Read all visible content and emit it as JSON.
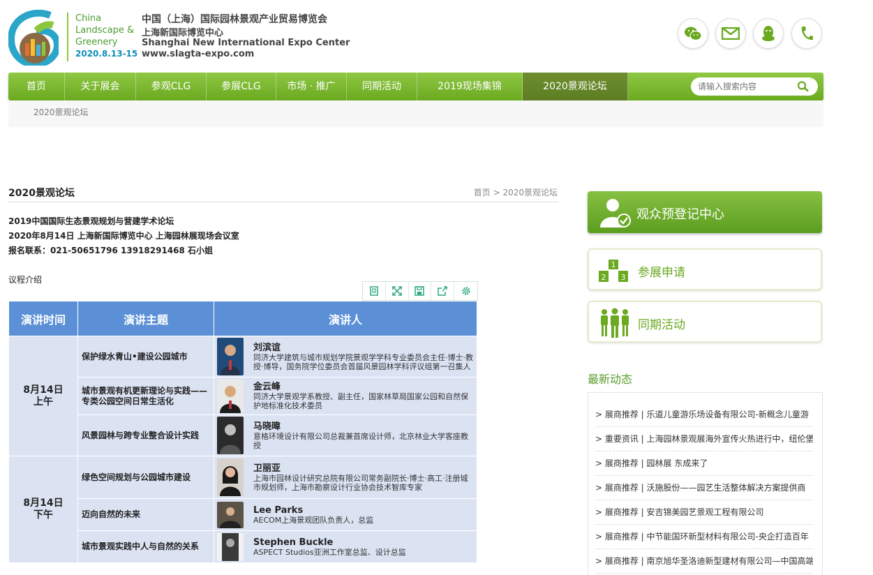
{
  "header": {
    "logo_lines": [
      "China",
      "Landscape &",
      "Greenery"
    ],
    "logo_date": "2020.8.13-15",
    "org_cn": "中国（上海）国际园林景观产业贸易博览会",
    "org_cn2": "上海新国际博览中心",
    "org_en": "Shanghai New International Expo Center",
    "url": "www.slagta-expo.com"
  },
  "nav": {
    "items": [
      "首页",
      "关于展会",
      "参观CLG",
      "参展CLG",
      "市场 · 推广",
      "同期活动",
      "2019现场集锦",
      "2020景观论坛"
    ],
    "active_index": 7,
    "search_placeholder": "请输入搜索内容"
  },
  "crumb_strip": "2020景观论坛",
  "main": {
    "title": "2020景观论坛",
    "breadcrumb": "首页 > 2020景观论坛",
    "info": [
      "2019中国国际生态景观规划与营建学术论坛",
      "2020年8月14日 上海新国际博览中心 上海园林展现场会议室",
      "报名联系：021-50651796 13918291468 石小姐"
    ],
    "agenda_label": "议程介绍"
  },
  "table": {
    "headers": [
      "演讲时间",
      "演讲主题",
      "演讲人"
    ],
    "sessions": [
      {
        "time": [
          "8月14日",
          "上午"
        ],
        "rows": [
          {
            "topic": "保护绿水青山•建设公园城市",
            "name": "刘滨谊",
            "desc": "同济大学建筑与城市规划学院景观学学科专业委员会主任·博士·教授·博导，国务院学位委员会首届风景园林学科评议组第一召集人"
          },
          {
            "topic": "城市景观有机更新理论与实践——专类公园空间日常生活化",
            "name": "金云峰",
            "desc": "同济大学景观学系教授、副主任，国家林草局国家公园和自然保护地标准化技术委员"
          },
          {
            "topic": "风景园林与跨专业整合设计实践",
            "name": "马晓暐",
            "desc": "意格环境设计有限公司总裁兼首席设计师，北京林业大学客座教授"
          }
        ]
      },
      {
        "time": [
          "8月14日",
          "下午"
        ],
        "rows": [
          {
            "topic": "绿色空间规划与公园城市建设",
            "name": "卫丽亚",
            "desc": "上海市园林设计研究总院有限公司常务副院长·博士·高工·注册城市规划师，上海市勘察设计行业协会技术智库专家"
          },
          {
            "topic": "迈向自然的未来",
            "name": "Lee Parks",
            "desc": "AECOM上海景观团队负责人，总监"
          },
          {
            "topic": "城市景观实践中人与自然的关系",
            "name": "Stephen Buckle",
            "desc": "ASPECT Studios亚洲工作室总监、设计总监"
          }
        ]
      }
    ]
  },
  "side": {
    "register": "观众预登记中心",
    "exhibit": "参展申请",
    "events": "同期活动",
    "news_heading": "最新动态",
    "news": [
      "> 展商推荐 | 乐道儿童游乐场设备有限公司-新概念儿童游",
      "> 重要资讯 | 上海园林景观展海外宣传火热进行中，纽伦堡",
      "> 展商推荐 | 园林展 东成来了",
      "> 展商推荐 | 沃施股份——园艺生活整体解决方案提供商",
      "> 展商推荐 | 安吉锦美园艺景观工程有限公司",
      "> 展商推荐 | 中节能国环新型材料有限公司-央企打造百年",
      "> 展商推荐 | 南京旭华圣洛迪新型建材有限公司—中国高端"
    ]
  },
  "colors": {
    "brand_green": "#6aa920",
    "table_header": "#5b8fd6",
    "table_cell": "#dbe3f3"
  }
}
